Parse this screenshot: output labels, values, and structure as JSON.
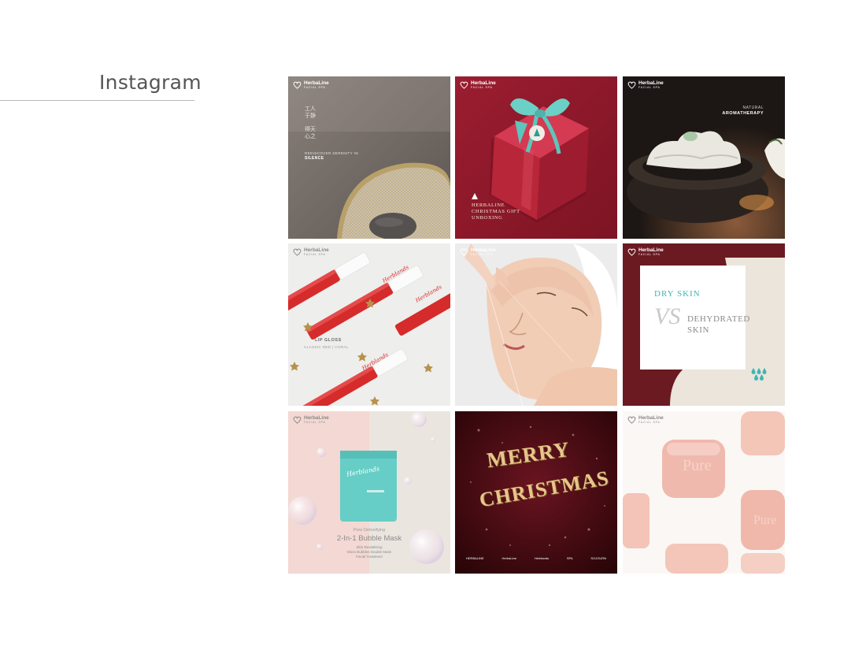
{
  "section": {
    "title": "Instagram"
  },
  "brand": {
    "name": "HerbaLine",
    "tagline": "FACIAL SPA"
  },
  "tiles": [
    {
      "id": "silence",
      "cjk": [
        "工",
        "人",
        "于",
        "静",
        "得",
        "天",
        "心",
        "之"
      ],
      "line1": "REDISCOVER SERENITY IN",
      "line2": "SILENCE"
    },
    {
      "id": "gift",
      "lines": [
        "HERBALINE",
        "CHRISTMAS GIFT",
        "UNBOXING"
      ]
    },
    {
      "id": "aroma",
      "line1": "NATURAL",
      "line2": "AROMATHERAPY"
    },
    {
      "id": "lipgloss",
      "brand_script": "Herblands",
      "title": "LIP GLOSS",
      "variant1": "CLASSIC RED",
      "separator": "|",
      "variant2": "CORAL"
    },
    {
      "id": "facial"
    },
    {
      "id": "dryskin",
      "left": "DRY SKIN",
      "vs": "VS",
      "right1": "DEHYDRATED",
      "right2": "SKIN"
    },
    {
      "id": "mask",
      "brand_script": "Herblands",
      "subtitle": "Pore Detoxifying",
      "title": "2-In-1 Bubble Mask",
      "desc1": "Skin Revitalising",
      "desc2": "Micro Bubbles Double Mask",
      "desc3": "Facial Treatment"
    },
    {
      "id": "christmas",
      "line1": "MERRY",
      "line2": "CHRISTMAS",
      "partners": [
        "HERBALINE",
        "HerbaLine",
        "Herblands",
        "SPA",
        "SOJOURN"
      ]
    },
    {
      "id": "soap",
      "emboss": "Pure"
    }
  ],
  "colors": {
    "teal": "#3fb6b2",
    "gold": "#d8b772",
    "burgundy": "#6b1a22",
    "red": "#b8263a"
  }
}
